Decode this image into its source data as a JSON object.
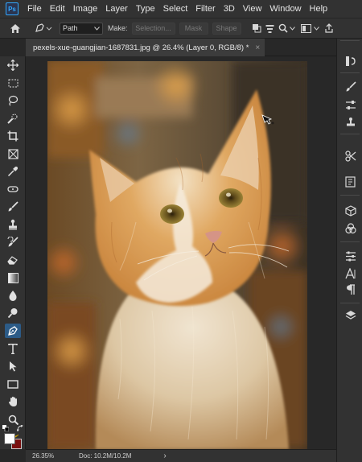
{
  "app": {
    "logo_text": "Ps"
  },
  "menu": [
    "File",
    "Edit",
    "Image",
    "Layer",
    "Type",
    "Select",
    "Filter",
    "3D",
    "View",
    "Window",
    "Help"
  ],
  "options_bar": {
    "mode_value": "Path",
    "make_label": "Make:",
    "selection_label": "Selection...",
    "mask_label": "Mask",
    "shape_label": "Shape"
  },
  "document": {
    "tab_title": "pexels-xue-guangjian-1687831.jpg @ 26.4% (Layer 0, RGB/8) *",
    "close_glyph": "×"
  },
  "status": {
    "zoom": "26.35%",
    "doc_size": "Doc: 10.2M/10.2M",
    "arrow": "›"
  },
  "colors": {
    "foreground": "#ffffff",
    "background": "#7a1010",
    "active_tool": "#2c5b87",
    "accent": "#31a8ff"
  },
  "tools": [
    "move-icon",
    "marquee-icon",
    "lasso-icon",
    "quick-select-icon",
    "crop-icon",
    "frame-icon",
    "eyedropper-icon",
    "healing-icon",
    "brush-icon",
    "stamp-icon",
    "history-brush-icon",
    "eraser-icon",
    "gradient-icon",
    "blur-icon",
    "dodge-icon",
    "pen-icon",
    "type-icon",
    "path-select-icon",
    "rectangle-icon",
    "hand-icon",
    "zoom-icon",
    "banana-icon"
  ]
}
